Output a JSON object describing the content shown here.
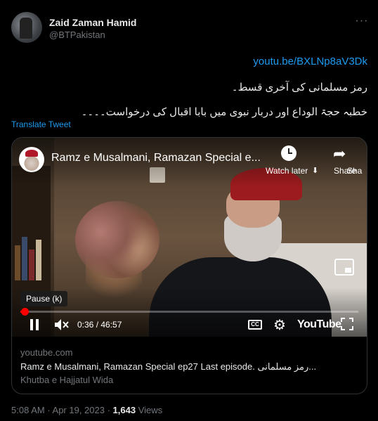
{
  "author": {
    "name": "Zaid Zaman Hamid",
    "handle": "@BTPakistan"
  },
  "more_icon": "ellipsis-icon",
  "tweet": {
    "link": "youtu.be/BXLNp8aV3Dk",
    "line1": "رمز مسلمانی کی آخری قسط۔",
    "line2": "خطبہ حجۃ الوداع اور دربار نبوی میں بابا اقبال کی درخواست۔۔۔۔",
    "translate": "Translate Tweet"
  },
  "video": {
    "title": "Ramz e Musalmani, Ramazan Special e...",
    "watch_later": "Watch later",
    "share": "Share",
    "overlap": "Sha",
    "tooltip": "Pause (k)",
    "time": "0:36 / 46:57",
    "progress_fraction": 0.013,
    "brand": "YouTube",
    "icons": [
      "clock-icon",
      "share-arrow-icon",
      "pip-icon",
      "pause-icon",
      "mute-icon",
      "cc-icon",
      "gear-icon",
      "fullscreen-icon"
    ]
  },
  "card": {
    "domain": "youtube.com",
    "title": "Ramz e Musalmani, Ramazan Special ep27 Last episode. رمز مسلمانی...",
    "description": "Khutba e Hajjatul Wida"
  },
  "meta": {
    "time": "5:08 AM · Apr 19, 2023 · ",
    "views_count": "1,643",
    "views_label": " Views"
  },
  "colors": {
    "background": "#000000",
    "link": "#1d9bf0",
    "muted": "#71767b",
    "text": "#e7e9ea",
    "progress": "#ff0000"
  }
}
